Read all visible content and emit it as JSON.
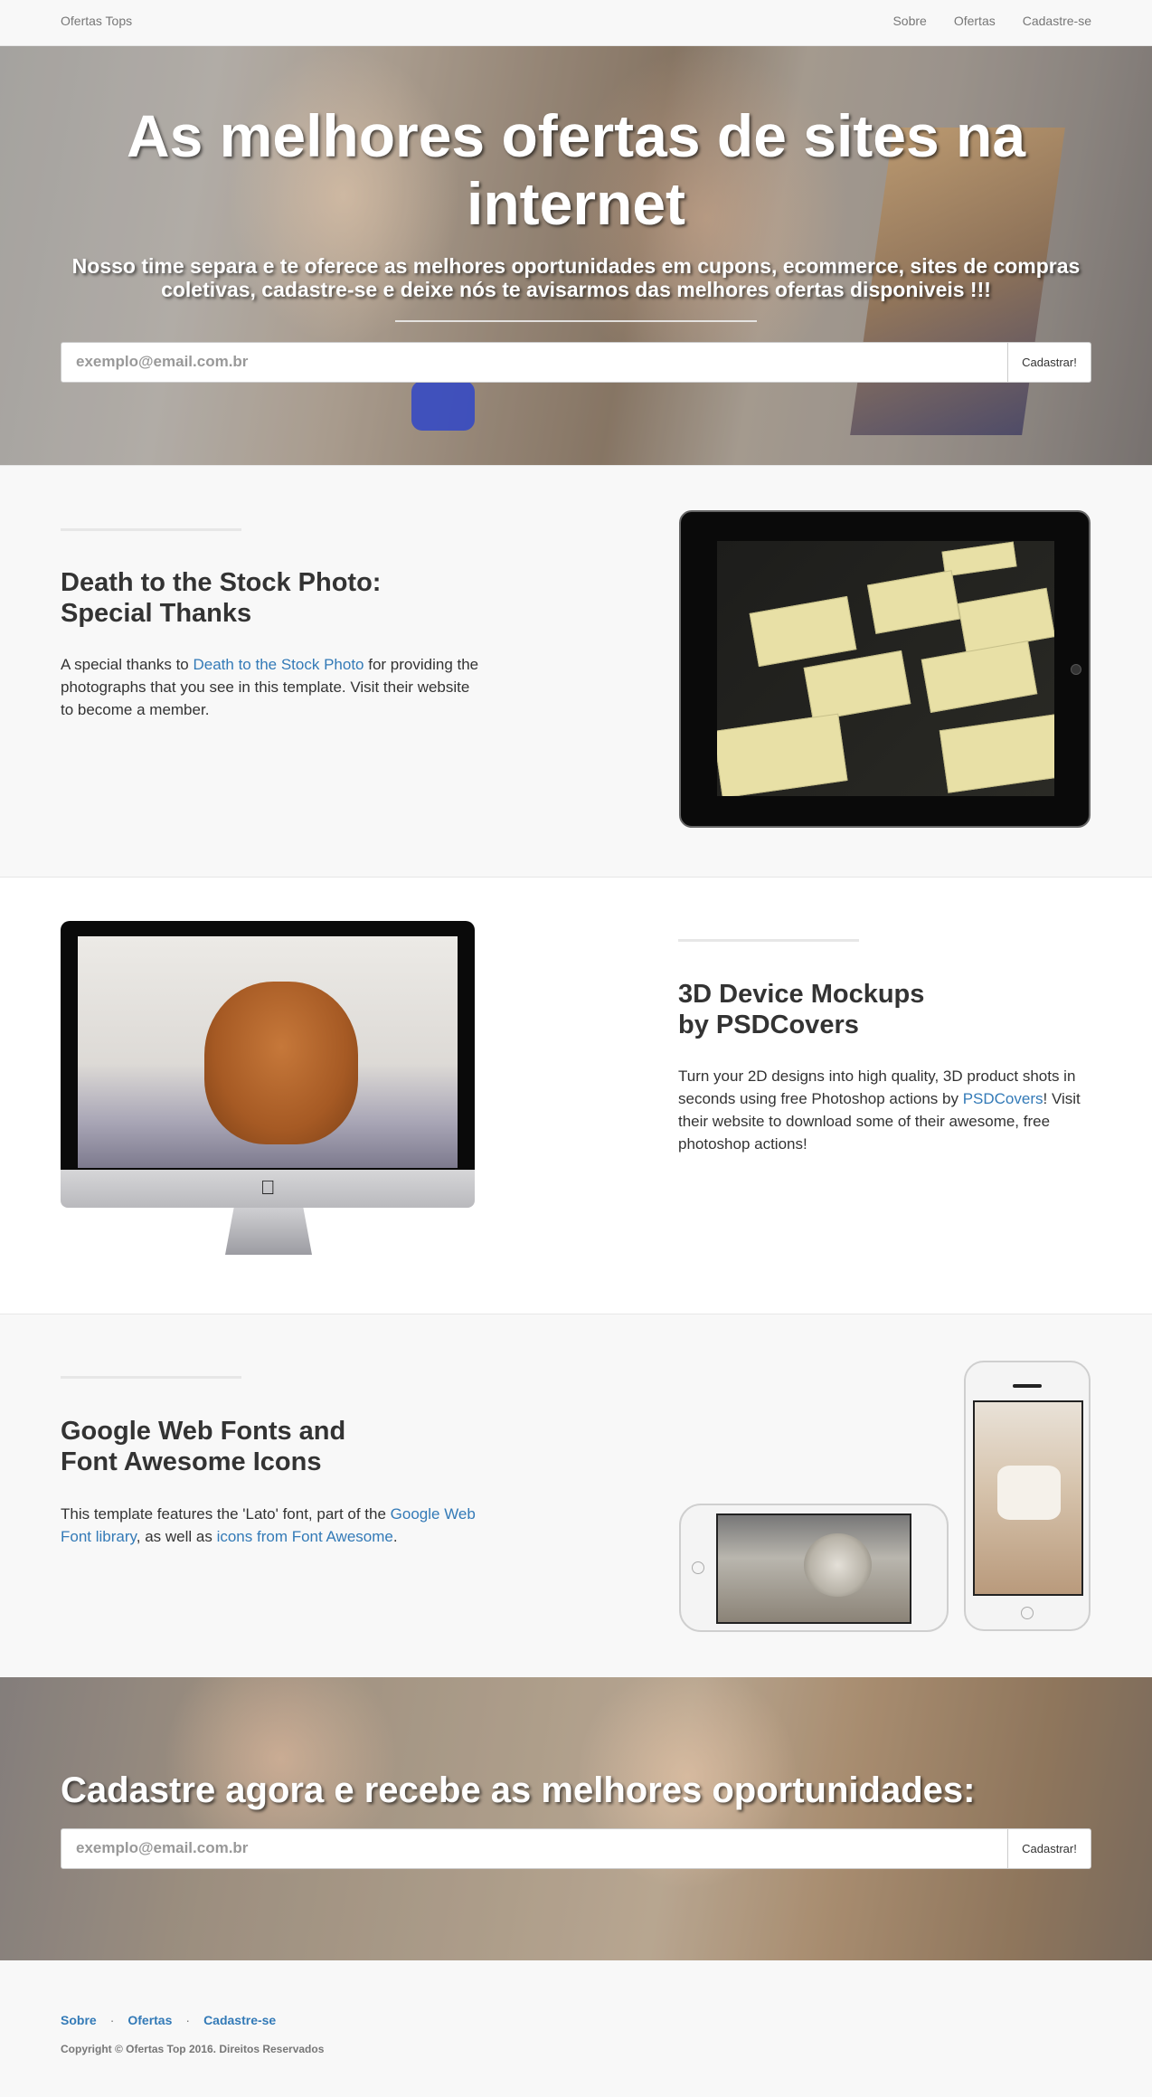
{
  "navbar": {
    "brand": "Ofertas Tops",
    "links": [
      "Sobre",
      "Ofertas",
      "Cadastre-se"
    ]
  },
  "hero": {
    "title": "As melhores ofertas de sites na internet",
    "subtitle": "Nosso time separa e te oferece as melhores oportunidades em cupons, ecommerce, sites de compras coletivas, cadastre-se e deixe nós te avisarmos das melhores ofertas disponiveis !!!",
    "email_placeholder": "exemplo@email.com.br",
    "submit_label": "Cadastrar!"
  },
  "sections": [
    {
      "title_line1": "Death to the Stock Photo:",
      "title_line2": "Special Thanks",
      "text_before": "A special thanks to ",
      "link": "Death to the Stock Photo",
      "text_after": " for providing the photographs that you see in this template. Visit their website to become a member."
    },
    {
      "title_line1": "3D Device Mockups",
      "title_line2": "by PSDCovers",
      "text_before": "Turn your 2D designs into high quality, 3D product shots in seconds using free Photoshop actions by ",
      "link": "PSDCovers",
      "text_after": "! Visit their website to download some of their awesome, free photoshop actions!"
    },
    {
      "title_line1": "Google Web Fonts and",
      "title_line2": "Font Awesome Icons",
      "text_before": "This template features the 'Lato' font, part of the ",
      "link": "Google Web Font library",
      "text_middle": ", as well as ",
      "link2": "icons from Font Awesome",
      "text_after": "."
    }
  ],
  "banner": {
    "title": "Cadastre agora e recebe as melhores oportunidades:",
    "email_placeholder": "exemplo@email.com.br",
    "submit_label": "Cadastrar!"
  },
  "footer": {
    "links": [
      "Sobre",
      "Ofertas",
      "Cadastre-se"
    ],
    "separator": "·",
    "copyright": "Copyright © Ofertas Top 2016. Direitos Reservados"
  },
  "colors": {
    "link": "#337ab7",
    "nav_text": "#777777",
    "background": "#f8f8f8"
  },
  "icons": [
    "apple-logo-icon"
  ]
}
